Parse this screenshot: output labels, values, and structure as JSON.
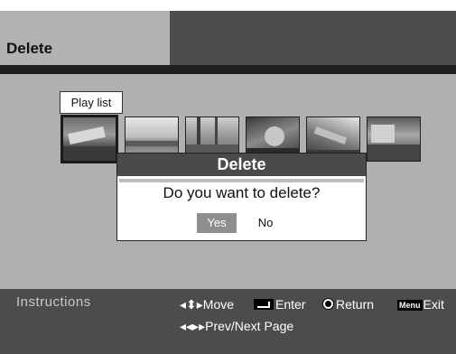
{
  "header": {
    "title": "Delete"
  },
  "content": {
    "playlist_label": "Play list"
  },
  "thumbnails": [
    {
      "name": "thumbnail-1",
      "selected": true
    },
    {
      "name": "thumbnail-2",
      "selected": false
    },
    {
      "name": "thumbnail-3",
      "selected": false
    },
    {
      "name": "thumbnail-4",
      "selected": false
    },
    {
      "name": "thumbnail-5",
      "selected": false
    },
    {
      "name": "thumbnail-6",
      "selected": false
    }
  ],
  "dialog": {
    "title": "Delete",
    "question": "Do you want to delete?",
    "yes_label": "Yes",
    "no_label": "No"
  },
  "footer": {
    "title": "Instructions",
    "move": "Move",
    "enter": "Enter",
    "return": "Return",
    "menu_key": "Menu",
    "exit": "Exit",
    "prev_next": "Prev/Next Page"
  },
  "icons": {
    "updown_arrows": "◂⬍▸",
    "leftright_arrows": "◂◂▸▸"
  }
}
